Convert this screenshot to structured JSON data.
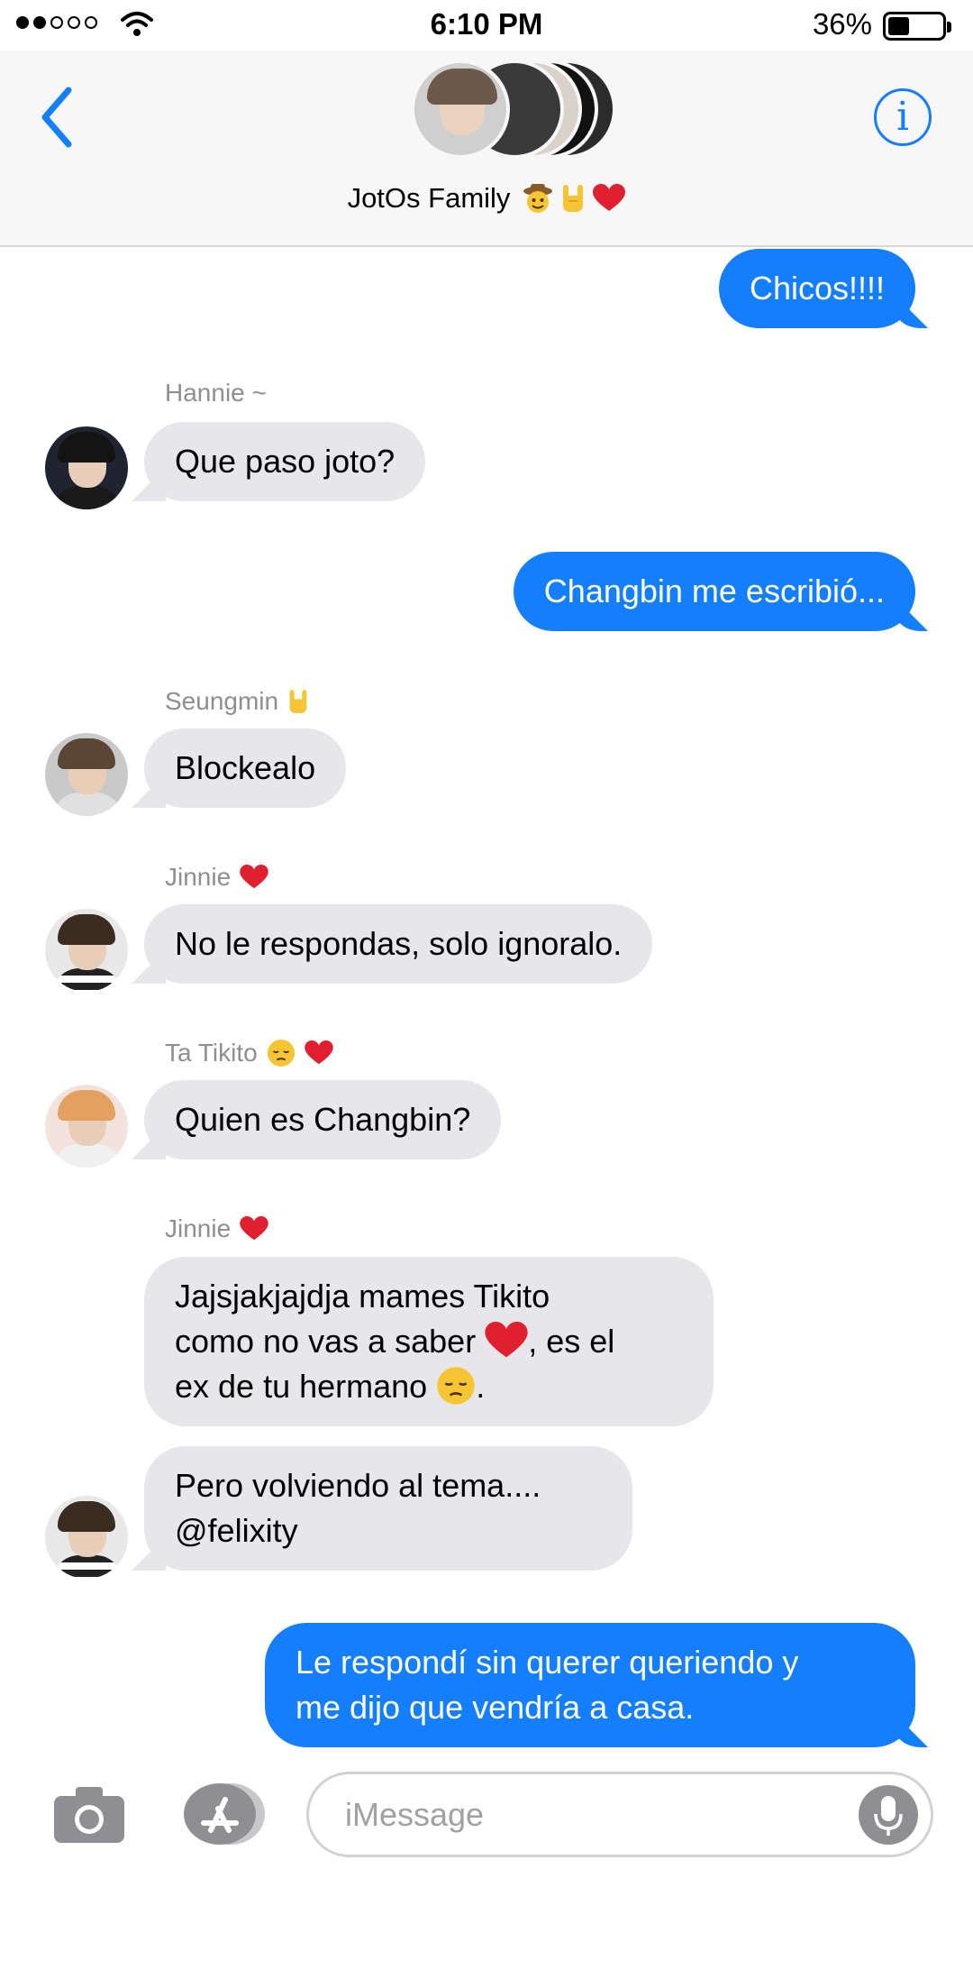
{
  "status_bar": {
    "time": "6:10 PM",
    "battery_percent": "36%",
    "battery_level": 0.36,
    "signal_bars_filled": 2,
    "signal_bars_total": 5
  },
  "header": {
    "group_name": "JotOs Family",
    "group_emojis": [
      "cowboy-emoji",
      "rock-on-emoji",
      "red-heart-emoji"
    ],
    "back_icon": "chevron-left-icon",
    "info_icon": "info-icon",
    "info_glyph": "i"
  },
  "messages": [
    {
      "direction": "outgoing",
      "text": "Chicos!!!!"
    },
    {
      "direction": "incoming",
      "sender": "Hannie ~",
      "text": "Que paso joto?"
    },
    {
      "direction": "outgoing",
      "text": "Changbin me escribió..."
    },
    {
      "direction": "incoming",
      "sender": "Seungmin",
      "sender_emojis": [
        "rock-on-emoji"
      ],
      "text": "Blockealo"
    },
    {
      "direction": "incoming",
      "sender": "Jinnie",
      "sender_emojis": [
        "red-heart-emoji"
      ],
      "text": "No le respondas, solo ignoralo."
    },
    {
      "direction": "incoming",
      "sender": "Ta Tikito",
      "sender_emojis": [
        "pensive-face-emoji",
        "red-heart-emoji"
      ],
      "text": "Quien es Changbin?"
    },
    {
      "direction": "incoming",
      "sender": "Jinnie",
      "sender_emojis": [
        "red-heart-emoji"
      ],
      "lines": [
        "Jajsjakjajdja mames Tikito",
        "como no vas a saber",
        ", es el",
        "ex de tu hermano",
        "."
      ]
    },
    {
      "direction": "incoming",
      "lines": [
        "Pero volviendo al tema....",
        "@felixity"
      ]
    },
    {
      "direction": "outgoing",
      "lines": [
        "Le respondí sin querer queriendo y",
        "me dijo que vendría a casa."
      ]
    }
  ],
  "input_bar": {
    "placeholder": "iMessage",
    "camera_icon": "camera-icon",
    "apps_icon": "app-store-icon",
    "mic_icon": "microphone-icon"
  },
  "colors": {
    "outgoing_bubble": "#147efb",
    "incoming_bubble": "#e6e6eb",
    "accent": "#147efb",
    "sender_label": "#8e8e93"
  }
}
